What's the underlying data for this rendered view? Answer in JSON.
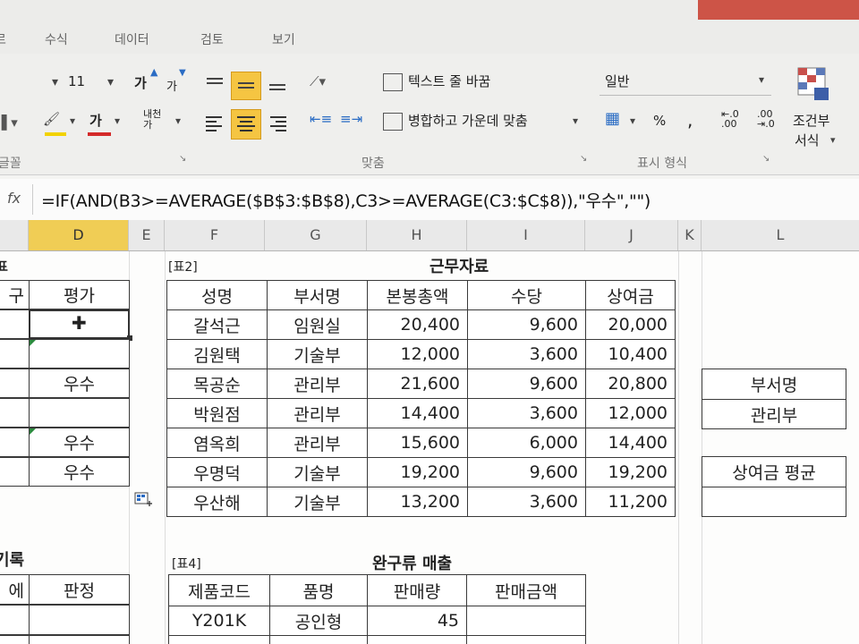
{
  "menu": [
    "수식",
    "데이터",
    "검토",
    "보기"
  ],
  "ribbon": {
    "font_size": "11",
    "wrap_text": "텍스트 줄 바꿈",
    "merge_center": "병합하고 가운데 맞춤",
    "number_format": "일반",
    "percent": "%",
    "comma": ",",
    "cond_format_1": "조건부",
    "cond_format_2": "서식",
    "group_font": "글꼴",
    "group_align": "맞춤",
    "group_number": "표시 형식"
  },
  "formula_bar": {
    "fx": "fx",
    "formula": "=IF(AND(B3>=AVERAGE($B$3:$B$8),C3>=AVERAGE(C3:$C$8)),\"우수\",\"\")"
  },
  "columns": [
    "D",
    "E",
    "F",
    "G",
    "H",
    "I",
    "J",
    "K",
    "L"
  ],
  "table1": {
    "header_left": "구",
    "header": "평가",
    "values": [
      "",
      "",
      "우수",
      "",
      "우수",
      "우수"
    ]
  },
  "table2": {
    "tag": "[표2]",
    "title": "근무자료",
    "headers": [
      "성명",
      "부서명",
      "본봉총액",
      "수당",
      "상여금"
    ],
    "rows": [
      [
        "갈석근",
        "임원실",
        "20,400",
        "9,600",
        "20,000"
      ],
      [
        "김원택",
        "기술부",
        "12,000",
        "3,600",
        "10,400"
      ],
      [
        "목공순",
        "관리부",
        "21,600",
        "9,600",
        "20,800"
      ],
      [
        "박원점",
        "관리부",
        "14,400",
        "3,600",
        "12,000"
      ],
      [
        "염옥희",
        "관리부",
        "15,600",
        "6,000",
        "14,400"
      ],
      [
        "우명덕",
        "기술부",
        "19,200",
        "9,600",
        "19,200"
      ],
      [
        "우산해",
        "기술부",
        "13,200",
        "3,600",
        "11,200"
      ]
    ]
  },
  "criteria": {
    "label": "부서명",
    "value": "관리부",
    "result_label": "상여금 평균",
    "result_value": ""
  },
  "table3": {
    "title": "기록",
    "header_left": "에",
    "header": "판정"
  },
  "table4": {
    "tag": "[표4]",
    "title": "완구류 매출",
    "headers": [
      "제품코드",
      "품명",
      "판매량",
      "판매금액"
    ],
    "rows": [
      [
        "Y201K",
        "공인형",
        "45",
        ""
      ]
    ]
  },
  "colors": {
    "selected_header": "#f0cd55",
    "highlight_button": "#f5c542",
    "grid": "#3a3a3a"
  }
}
